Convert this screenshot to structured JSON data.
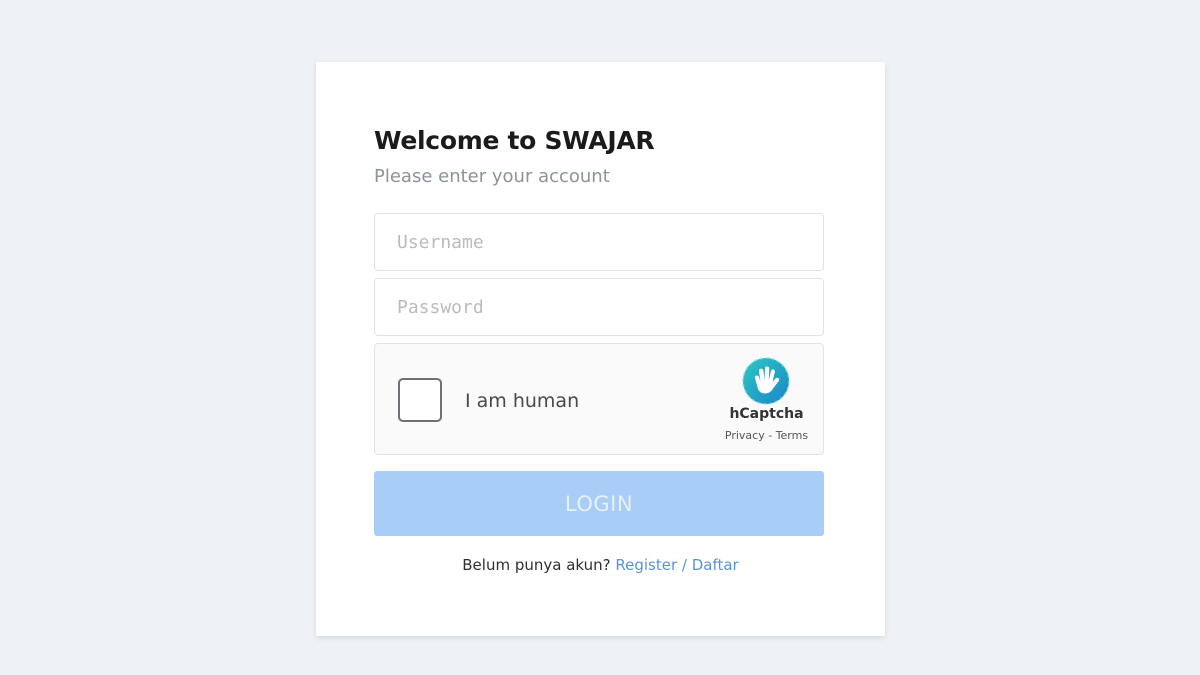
{
  "header": {
    "title": "Welcome to SWAJAR",
    "subtitle": "Please enter your account"
  },
  "form": {
    "username_placeholder": "Username",
    "username_value": "",
    "password_placeholder": "Password",
    "password_value": ""
  },
  "captcha": {
    "checkbox_checked": false,
    "label": "I am human",
    "brand": "hCaptcha",
    "privacy_label": "Privacy",
    "separator": " - ",
    "terms_label": "Terms"
  },
  "login": {
    "button_label": "LOGIN"
  },
  "register": {
    "prompt": "Belum punya akun? ",
    "link_label": "Register / Daftar"
  },
  "colors": {
    "page_background": "#eef2f7",
    "card_background": "#ffffff",
    "login_button": "#a8cdf6",
    "link": "#5a93d6",
    "hcaptcha_teal": "#1ca8b9"
  },
  "icons": {
    "captcha_logo": "hcaptcha-hand-icon"
  }
}
